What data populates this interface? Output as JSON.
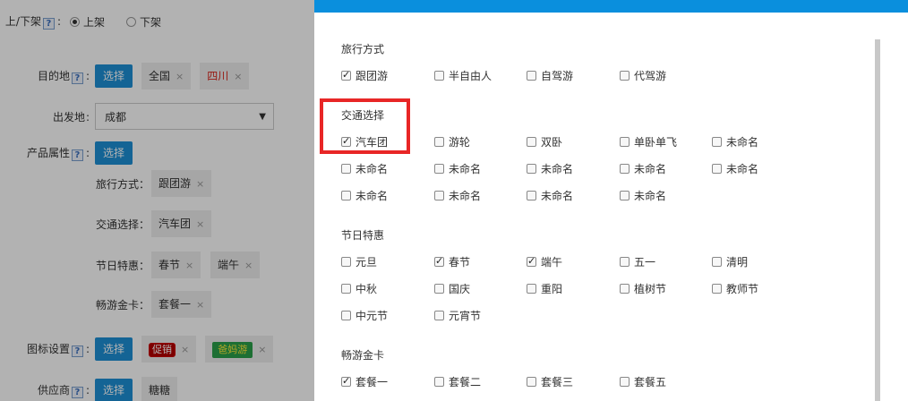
{
  "form": {
    "listing": {
      "label": "上/下架",
      "on": "上架",
      "off": "下架"
    },
    "destination": {
      "label": "目的地",
      "select_btn": "选择",
      "tags": [
        "全国",
        "四川"
      ]
    },
    "departure": {
      "label": "出发地",
      "value": "成都"
    },
    "attributes": {
      "label": "产品属性",
      "select_btn": "选择"
    },
    "travel_mode": {
      "label": "旅行方式：",
      "tags": [
        "跟团游"
      ]
    },
    "transport": {
      "label": "交通选择：",
      "tags": [
        "汽车团"
      ]
    },
    "festival": {
      "label": "节日特惠：",
      "tags": [
        "春节",
        "端午"
      ]
    },
    "golden_card": {
      "label": "畅游金卡：",
      "tags": [
        "套餐一"
      ]
    },
    "icon_setting": {
      "label": "图标设置",
      "select_btn": "选择",
      "badges": [
        "促销",
        "爸妈游"
      ]
    },
    "supplier": {
      "label": "供应商",
      "select_btn": "选择",
      "tags": [
        "糖糖"
      ]
    },
    "close_glyph": "×"
  },
  "modal": {
    "sections": [
      {
        "title": "旅行方式",
        "options": [
          {
            "label": "跟团游",
            "checked": true
          },
          {
            "label": "半自由人",
            "checked": false
          },
          {
            "label": "自驾游",
            "checked": false
          },
          {
            "label": "代驾游",
            "checked": false
          }
        ]
      },
      {
        "title": "交通选择",
        "options": [
          {
            "label": "汽车团",
            "checked": true
          },
          {
            "label": "游轮",
            "checked": false
          },
          {
            "label": "双卧",
            "checked": false
          },
          {
            "label": "单卧单飞",
            "checked": false
          },
          {
            "label": "未命名",
            "checked": false
          },
          {
            "label": "未命名",
            "checked": false
          },
          {
            "label": "未命名",
            "checked": false
          },
          {
            "label": "未命名",
            "checked": false
          },
          {
            "label": "未命名",
            "checked": false
          },
          {
            "label": "未命名",
            "checked": false
          },
          {
            "label": "未命名",
            "checked": false
          },
          {
            "label": "未命名",
            "checked": false
          },
          {
            "label": "未命名",
            "checked": false
          },
          {
            "label": "未命名",
            "checked": false
          }
        ]
      },
      {
        "title": "节日特惠",
        "options": [
          {
            "label": "元旦",
            "checked": false
          },
          {
            "label": "春节",
            "checked": true
          },
          {
            "label": "端午",
            "checked": true
          },
          {
            "label": "五一",
            "checked": false
          },
          {
            "label": "清明",
            "checked": false
          },
          {
            "label": "中秋",
            "checked": false
          },
          {
            "label": "国庆",
            "checked": false
          },
          {
            "label": "重阳",
            "checked": false
          },
          {
            "label": "植树节",
            "checked": false
          },
          {
            "label": "教师节",
            "checked": false
          },
          {
            "label": "中元节",
            "checked": false
          },
          {
            "label": "元宵节",
            "checked": false
          }
        ]
      },
      {
        "title": "畅游金卡",
        "options": [
          {
            "label": "套餐一",
            "checked": true
          },
          {
            "label": "套餐二",
            "checked": false
          },
          {
            "label": "套餐三",
            "checked": false
          },
          {
            "label": "套餐五",
            "checked": false
          }
        ]
      }
    ]
  },
  "colors": {
    "accent": "#0a8fdd",
    "button": "#1e90d6",
    "highlight": "#e82626"
  }
}
